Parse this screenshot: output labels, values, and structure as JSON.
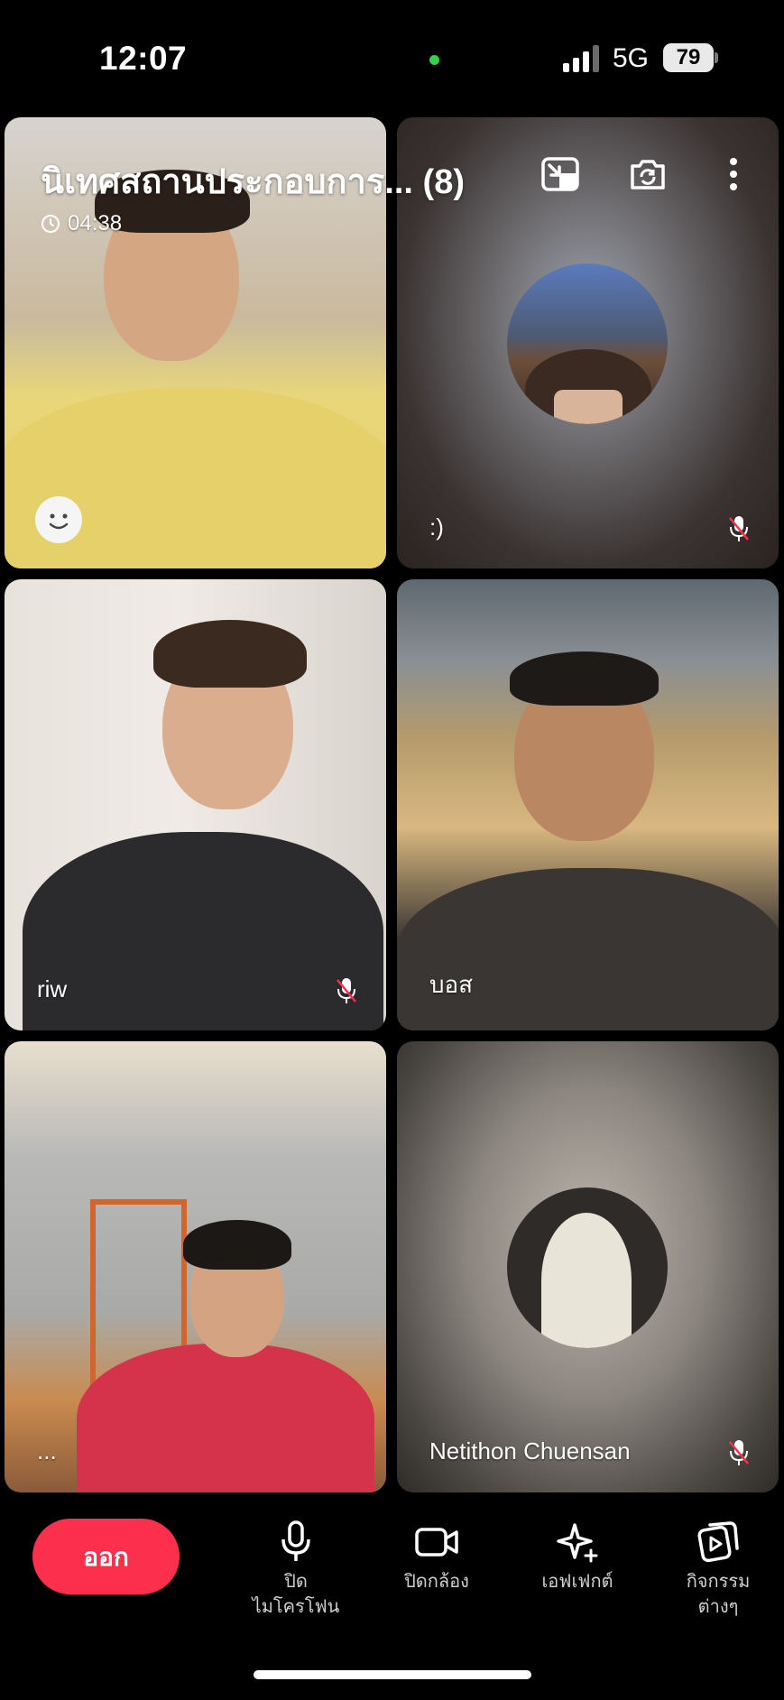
{
  "status_bar": {
    "time": "12:07",
    "network": "5G",
    "battery": "79"
  },
  "call": {
    "title": "นิเทศสถานประกอบการ...",
    "participant_count": "(8)",
    "timer": "04:38"
  },
  "tiles": [
    {
      "name": "",
      "mic_muted": false,
      "video": true
    },
    {
      "name": ":)",
      "mic_muted": true,
      "video": false
    },
    {
      "name": "riw",
      "mic_muted": true,
      "video": true
    },
    {
      "name": "บอส",
      "mic_muted": false,
      "video": true
    },
    {
      "name": "...",
      "mic_muted": false,
      "video": true
    },
    {
      "name": "Netithon Chuensan",
      "mic_muted": true,
      "video": false
    }
  ],
  "controls": {
    "leave": "ออก",
    "mic_line1": "ปิด",
    "mic_line2": "ไมโครโฟน",
    "camera": "ปิดกล้อง",
    "effects": "เอฟเฟกต์",
    "activities_line1": "กิจกรรม",
    "activities_line2": "ต่างๆ"
  },
  "colors": {
    "leave_button": "#fc2f4d",
    "active_dot": "#2fd24b",
    "background": "#000000"
  }
}
